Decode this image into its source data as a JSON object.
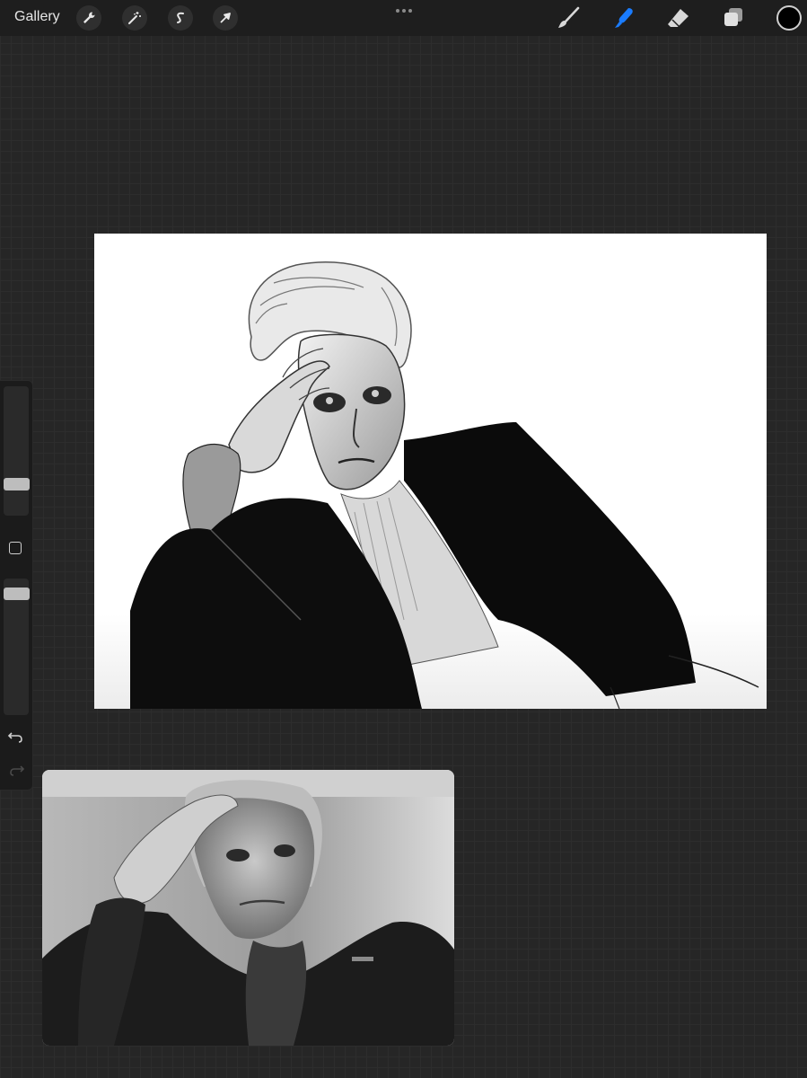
{
  "toolbar": {
    "gallery_label": "Gallery",
    "left_tools": [
      {
        "icon": "wrench-icon",
        "name": "actions"
      },
      {
        "icon": "magic-wand-icon",
        "name": "adjustments"
      },
      {
        "icon": "selection-icon",
        "name": "selection"
      },
      {
        "icon": "arrow-cursor-icon",
        "name": "transform"
      }
    ],
    "more_icon": "more-dots-icon",
    "right_tools": [
      {
        "icon": "brush-icon",
        "name": "paint",
        "active": false
      },
      {
        "icon": "smudge-icon",
        "name": "smudge",
        "active": true
      },
      {
        "icon": "eraser-icon",
        "name": "erase",
        "active": false
      },
      {
        "icon": "layers-icon",
        "name": "layers",
        "active": false
      }
    ],
    "color": {
      "current": "#000000"
    }
  },
  "sidebar": {
    "brush_size": 0.28,
    "opacity": 0.92,
    "modify_icon": "square-icon",
    "undo_icon": "undo-icon",
    "redo_icon": "redo-icon",
    "redo_enabled": false
  },
  "colors": {
    "accent": "#1a7cff",
    "background": "#262626",
    "topbar": "#1e1e1e"
  }
}
